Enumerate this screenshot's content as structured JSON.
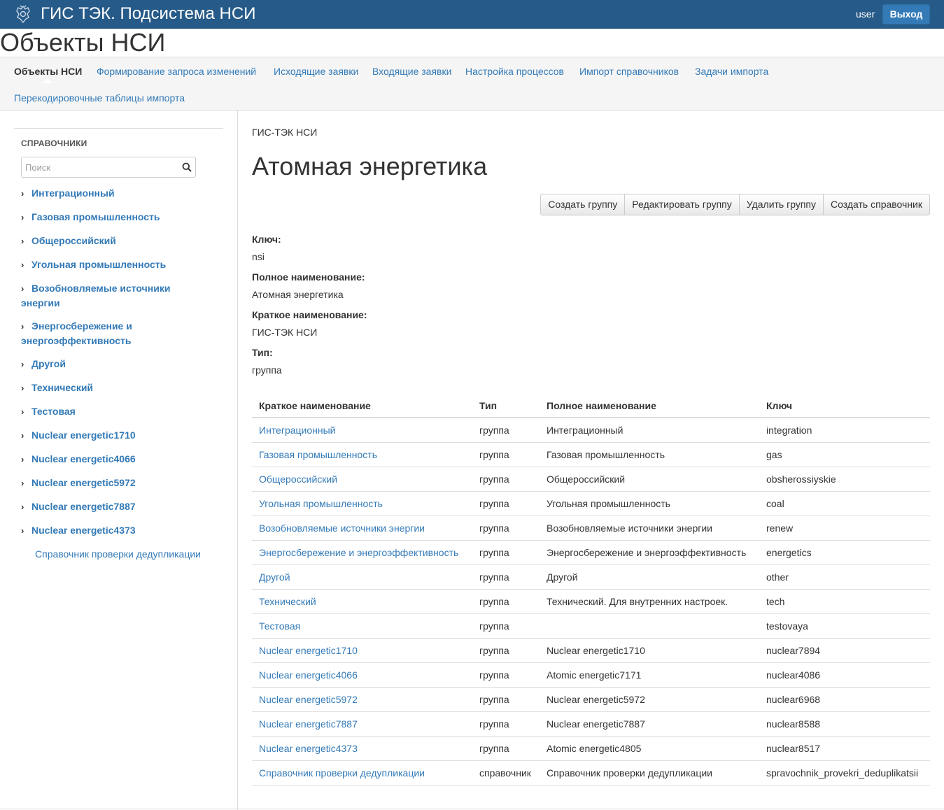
{
  "header": {
    "brand": "ГИС ТЭК. Подсистема НСИ",
    "user": "user",
    "logout_label": "Выход"
  },
  "page_title": "Объекты НСИ",
  "subnav": {
    "items": [
      {
        "label": "Объекты НСИ",
        "active": true
      },
      {
        "label": "Формирование запроса изменений"
      },
      {
        "label": "Исходящие заявки"
      },
      {
        "label": "Входящие заявки"
      },
      {
        "label": "Настройка процессов"
      },
      {
        "label": "Импорт справочников"
      },
      {
        "label": "Задачи импорта"
      },
      {
        "label": "Перекодировочные таблицы импорта"
      }
    ]
  },
  "sidebar": {
    "heading": "СПРАВОЧНИКИ",
    "search_placeholder": "Поиск",
    "items": [
      {
        "label": "Интеграционный"
      },
      {
        "label": "Газовая промышленность"
      },
      {
        "label": "Общероссийский"
      },
      {
        "label": "Угольная промышленность"
      },
      {
        "label": "Возобновляемые источники энергии"
      },
      {
        "label": "Энергосбережение и энергоэффективность"
      },
      {
        "label": "Другой"
      },
      {
        "label": "Технический"
      },
      {
        "label": "Тестовая"
      },
      {
        "label": "Nuclear energetic1710"
      },
      {
        "label": "Nuclear energetic4066"
      },
      {
        "label": "Nuclear energetic5972"
      },
      {
        "label": "Nuclear energetic7887"
      },
      {
        "label": "Nuclear energetic4373"
      }
    ],
    "leaf": "Справочник проверки дедупликации"
  },
  "main": {
    "breadcrumb": "ГИС-ТЭК НСИ",
    "heading": "Атомная энергетика",
    "buttons": {
      "create_group": "Создать группу",
      "edit_group": "Редактировать группу",
      "delete_group": "Удалить группу",
      "create_dict": "Создать справочник"
    },
    "props": {
      "key_label": "Ключ:",
      "key_value": "nsi",
      "full_label": "Полное наименование:",
      "full_value": "Атомная энергетика",
      "short_label": "Краткое наименование:",
      "short_value": "ГИС-ТЭК НСИ",
      "type_label": "Тип:",
      "type_value": "группа"
    },
    "table": {
      "headers": [
        "Краткое наименование",
        "Тип",
        "Полное наименование",
        "Ключ"
      ],
      "rows": [
        [
          "Интеграционный",
          "группа",
          "Интеграционный",
          "integration"
        ],
        [
          "Газовая промышленность",
          "группа",
          "Газовая промышленность",
          "gas"
        ],
        [
          "Общероссийский",
          "группа",
          "Общероссийский",
          "obsherossiyskie"
        ],
        [
          "Угольная промышленность",
          "группа",
          "Угольная промышленность",
          "coal"
        ],
        [
          "Возобновляемые источники энергии",
          "группа",
          "Возобновляемые источники энергии",
          "renew"
        ],
        [
          "Энергосбережение и энергоэффективность",
          "группа",
          "Энергосбережение и энергоэффективность",
          "energetics"
        ],
        [
          "Другой",
          "группа",
          "Другой",
          "other"
        ],
        [
          "Технический",
          "группа",
          "Технический. Для внутренних настроек.",
          "tech"
        ],
        [
          "Тестовая",
          "группа",
          "",
          "testovaya"
        ],
        [
          "Nuclear energetic1710",
          "группа",
          "Nuclear energetic1710",
          "nuclear7894"
        ],
        [
          "Nuclear energetic4066",
          "группа",
          "Atomic energetic7171",
          "nuclear4086"
        ],
        [
          "Nuclear energetic5972",
          "группа",
          "Nuclear energetic5972",
          "nuclear6968"
        ],
        [
          "Nuclear energetic7887",
          "группа",
          "Nuclear energetic7887",
          "nuclear8588"
        ],
        [
          "Nuclear energetic4373",
          "группа",
          "Atomic energetic4805",
          "nuclear8517"
        ],
        [
          "Справочник проверки дедупликации",
          "справочник",
          "Справочник проверки дедупликации",
          "spravochnik_provekri_deduplikatsii"
        ]
      ]
    }
  },
  "colors": {
    "header_bg": "#265a88",
    "link": "#337ab7",
    "logout_bg": "#337ab7"
  },
  "icons": {
    "emblem": "emblem-icon",
    "search": "search-icon",
    "chevron": "chevron-right-icon"
  }
}
